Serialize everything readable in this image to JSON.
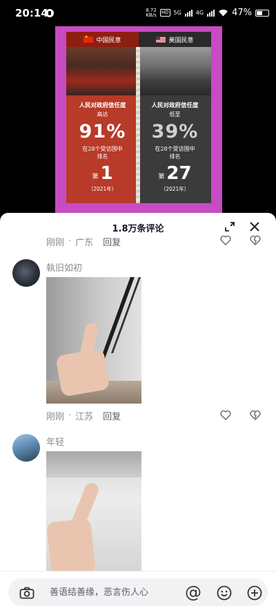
{
  "status_bar": {
    "time": "20:14",
    "net_speed_value": "8.72",
    "net_speed_unit": "KB/s",
    "hd": "HD",
    "net1": "5G",
    "net2": "4G",
    "battery": "47%"
  },
  "poster": {
    "left": {
      "header": "中国民意",
      "title": "人民对政府信任度",
      "level": "高达",
      "percent": "91%",
      "desc_line1": "在28个受访国中",
      "desc_line2": "排名",
      "rank_label": "第",
      "rank": "1",
      "year": "（2021年）"
    },
    "right": {
      "header": "美国民意",
      "title": "人民对政府信任度",
      "level": "低至",
      "percent": "39%",
      "desc_line1": "在28个受访国中",
      "desc_line2": "排名",
      "rank_label": "第",
      "rank": "27",
      "year": "（2021年）"
    }
  },
  "comments_sheet": {
    "title": "1.8万条评论",
    "reply_label": "回复",
    "top_partial": {
      "time": "刚刚",
      "location": "广东"
    },
    "comments": [
      {
        "username": "執旧如初",
        "time": "刚刚",
        "location": "江苏"
      },
      {
        "username": "年轻"
      }
    ]
  },
  "input_bar": {
    "placeholder": "善语结善缘，恶言伤人心",
    "at_symbol": "@"
  },
  "icons": {
    "camera": "camera-icon",
    "emoji": "emoji-icon",
    "plus": "plus-icon",
    "heart": "heart-icon",
    "dislike": "dislike-icon",
    "expand": "expand-icon",
    "close": "close-icon"
  },
  "colors": {
    "poster_bg": "#c74bc2",
    "china_panel": "#b83a28",
    "us_panel": "#3b3b3b"
  }
}
